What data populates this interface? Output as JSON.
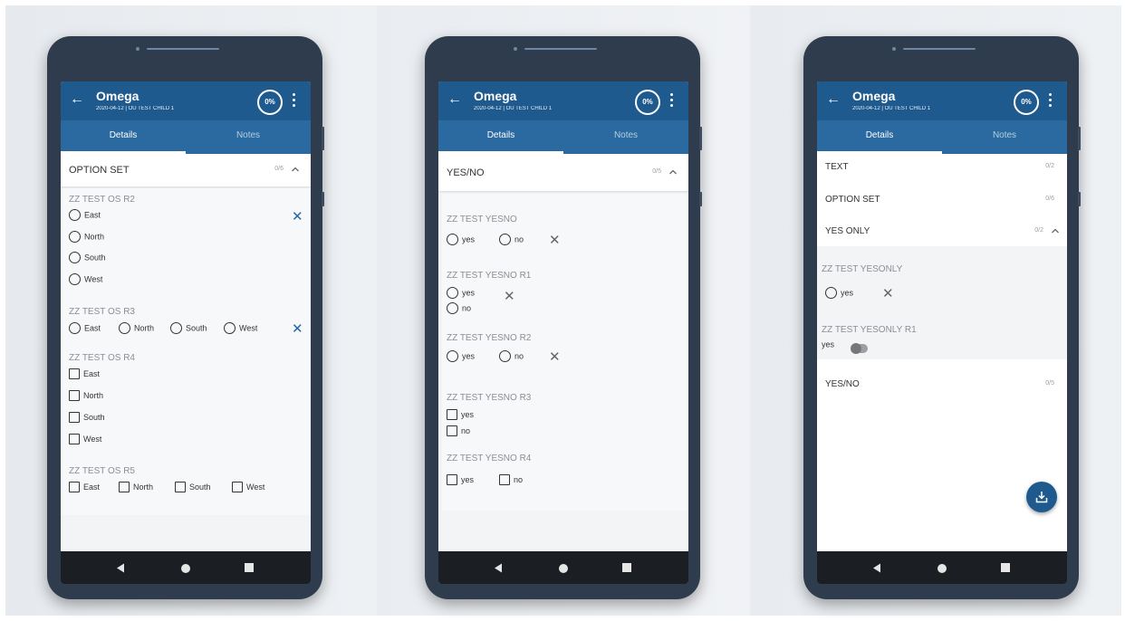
{
  "colors": {
    "app_bar": "#1f5a8e",
    "tab_bar": "#2a6aa0",
    "clear_icon_blue": "#2566a6",
    "clear_icon_grey": "#666666",
    "nav_bar": "#1b1f23"
  },
  "phones": [
    {
      "toolbar": {
        "title": "Omega",
        "subtitle": "2020-04-12 | OU TEST CHILD 1",
        "progress": "0%"
      },
      "tabs": {
        "details": "Details",
        "notes": "Notes"
      },
      "section": {
        "title": "OPTION SET",
        "count": "0/6"
      },
      "fields": {
        "r2": {
          "label": "ZZ TEST OS R2",
          "options": [
            "East",
            "North",
            "South",
            "West"
          ]
        },
        "r3": {
          "label": "ZZ TEST OS R3",
          "options": [
            "East",
            "North",
            "South",
            "West"
          ]
        },
        "r4": {
          "label": "ZZ TEST OS R4",
          "options": [
            "East",
            "North",
            "South",
            "West"
          ]
        },
        "r5": {
          "label": "ZZ TEST OS R5",
          "options": [
            "East",
            "North",
            "South",
            "West"
          ]
        }
      }
    },
    {
      "toolbar": {
        "title": "Omega",
        "subtitle": "2020-04-12 | OU TEST CHILD 1",
        "progress": "0%"
      },
      "tabs": {
        "details": "Details",
        "notes": "Notes"
      },
      "section": {
        "title": "YES/NO",
        "count": "0/5"
      },
      "fields": {
        "yesno": {
          "label": "ZZ TEST YESNO",
          "yes": "yes",
          "no": "no"
        },
        "r1": {
          "label": "ZZ TEST YESNO R1",
          "yes": "yes",
          "no": "no"
        },
        "r2": {
          "label": "ZZ TEST YESNO R2",
          "yes": "yes",
          "no": "no"
        },
        "r3": {
          "label": "ZZ TEST YESNO R3",
          "yes": "yes",
          "no": "no"
        },
        "r4": {
          "label": "ZZ TEST YESNO R4",
          "yes": "yes",
          "no": "no"
        }
      }
    },
    {
      "toolbar": {
        "title": "Omega",
        "subtitle": "2020-04-12 | OU TEST CHILD 1",
        "progress": "0%"
      },
      "tabs": {
        "details": "Details",
        "notes": "Notes"
      },
      "sections": [
        {
          "title": "TEXT",
          "count": "0/2"
        },
        {
          "title": "OPTION SET",
          "count": "0/6"
        },
        {
          "title": "YES ONLY",
          "count": "0/2"
        },
        {
          "title": "YES/NO",
          "count": "0/5"
        }
      ],
      "fields": {
        "yesonly": {
          "label": "ZZ TEST YESONLY",
          "yes": "yes"
        },
        "r1": {
          "label": "ZZ TEST YESONLY R1",
          "yes": "yes"
        }
      }
    }
  ]
}
